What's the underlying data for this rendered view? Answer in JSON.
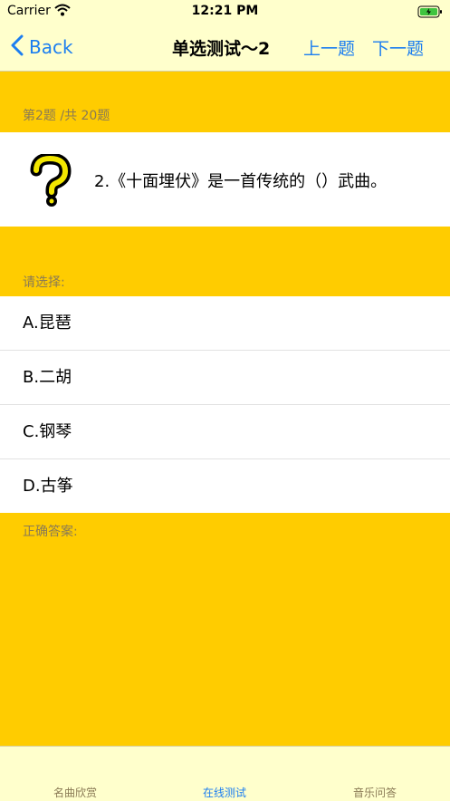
{
  "status": {
    "carrier": "Carrier",
    "time": "12:21 PM"
  },
  "nav": {
    "back_label": "Back",
    "title": "单选测试～2",
    "prev_label": "上一题",
    "next_label": "下一题"
  },
  "quiz": {
    "progress": "第2题 /共 20题",
    "question": "2.《十面埋伏》是一首传统的（）武曲。",
    "choose_label": "请选择:",
    "options": [
      "A.昆琶",
      "B.二胡",
      "C.钢琴",
      "D.古筝"
    ],
    "answer_label": "正确答案:"
  },
  "tabs": [
    {
      "label": "名曲欣赏",
      "active": false
    },
    {
      "label": "在线测试",
      "active": true
    },
    {
      "label": "音乐问答",
      "active": false
    }
  ],
  "colors": {
    "background": "#FFCC00",
    "bars": "#FFFFCC",
    "accent": "#1C7EF0"
  }
}
